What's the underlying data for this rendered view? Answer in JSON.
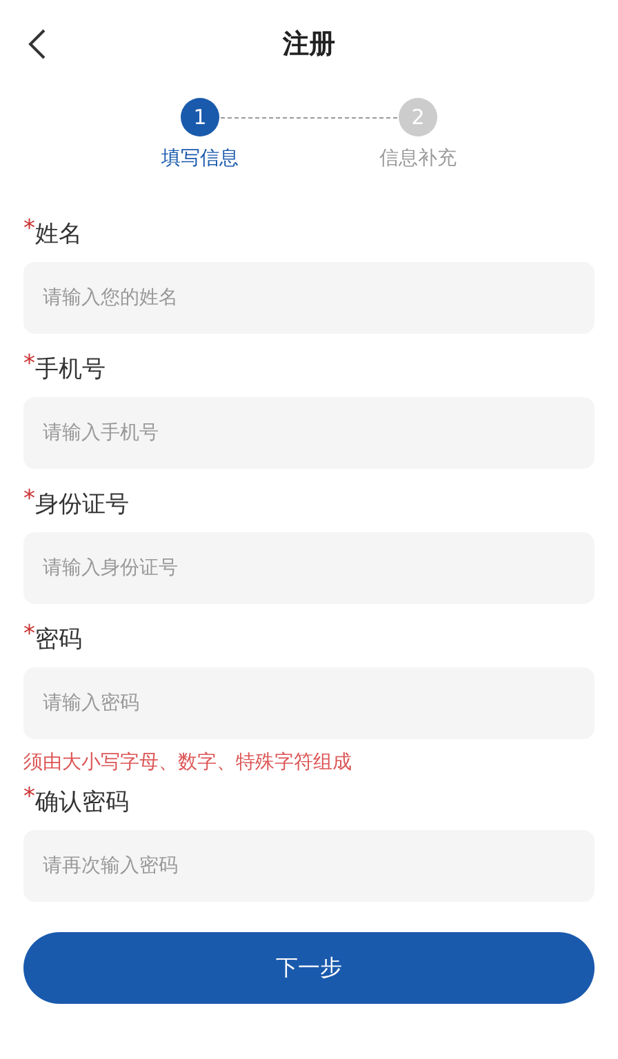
{
  "header": {
    "title": "注册"
  },
  "steps": [
    {
      "number": "1",
      "label": "填写信息",
      "selected": true
    },
    {
      "number": "2",
      "label": "信息补充",
      "selected": false
    }
  ],
  "fields": [
    {
      "mark": "*",
      "label": "姓名",
      "placeholder": "请输入您的姓名"
    },
    {
      "mark": "*",
      "label": "手机号",
      "placeholder": "请输入手机号"
    },
    {
      "mark": "*",
      "label": "身份证号",
      "placeholder": "请输入身份证号"
    },
    {
      "mark": "*",
      "label": "密码",
      "placeholder": "请输入密码",
      "hint": "须由大小写字母、数字、特殊字符组成"
    },
    {
      "mark": "*",
      "label": "确认密码",
      "placeholder": "请再次输入密码"
    }
  ],
  "submit": "下一步"
}
